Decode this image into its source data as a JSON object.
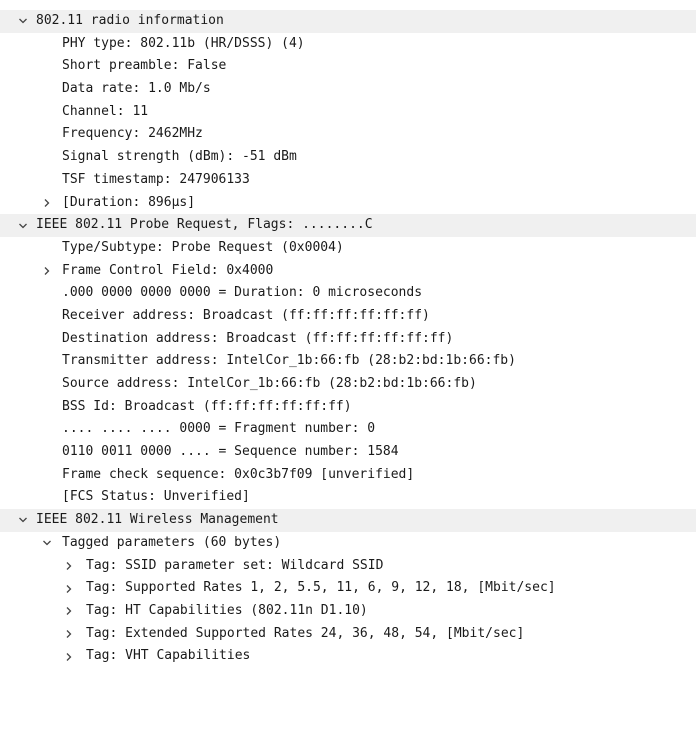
{
  "tree": {
    "radio": {
      "title": "802.11 radio information",
      "phy_type": "PHY type: 802.11b (HR/DSSS) (4)",
      "short_preamble": "Short preamble: False",
      "data_rate": "Data rate: 1.0 Mb/s",
      "channel": "Channel: 11",
      "frequency": "Frequency: 2462MHz",
      "signal_strength": "Signal strength (dBm): -51 dBm",
      "tsf_timestamp": "TSF timestamp: 247906133",
      "duration": "[Duration: 896µs]"
    },
    "probe": {
      "title": "IEEE 802.11 Probe Request, Flags: ........C",
      "type_subtype": "Type/Subtype: Probe Request (0x0004)",
      "frame_control": "Frame Control Field: 0x4000",
      "duration_bits": ".000 0000 0000 0000 = Duration: 0 microseconds",
      "receiver": "Receiver address: Broadcast (ff:ff:ff:ff:ff:ff)",
      "destination": "Destination address: Broadcast (ff:ff:ff:ff:ff:ff)",
      "transmitter": "Transmitter address: IntelCor_1b:66:fb (28:b2:bd:1b:66:fb)",
      "source": "Source address: IntelCor_1b:66:fb (28:b2:bd:1b:66:fb)",
      "bss_id": "BSS Id: Broadcast (ff:ff:ff:ff:ff:ff)",
      "fragment": ".... .... .... 0000 = Fragment number: 0",
      "sequence": "0110 0011 0000 .... = Sequence number: 1584",
      "fcs": "Frame check sequence: 0x0c3b7f09 [unverified]",
      "fcs_status": "[FCS Status: Unverified]"
    },
    "mgmt": {
      "title": "IEEE 802.11 Wireless Management",
      "tagged": {
        "title": "Tagged parameters (60 bytes)",
        "ssid": "Tag: SSID parameter set: Wildcard SSID",
        "rates": "Tag: Supported Rates 1, 2, 5.5, 11, 6, 9, 12, 18, [Mbit/sec]",
        "ht": "Tag: HT Capabilities (802.11n D1.10)",
        "ext_rates": "Tag: Extended Supported Rates 24, 36, 48, 54, [Mbit/sec]",
        "vht": "Tag: VHT Capabilities"
      }
    }
  },
  "icons": {
    "expanded": "chevron-down-icon",
    "collapsed": "chevron-right-icon"
  }
}
